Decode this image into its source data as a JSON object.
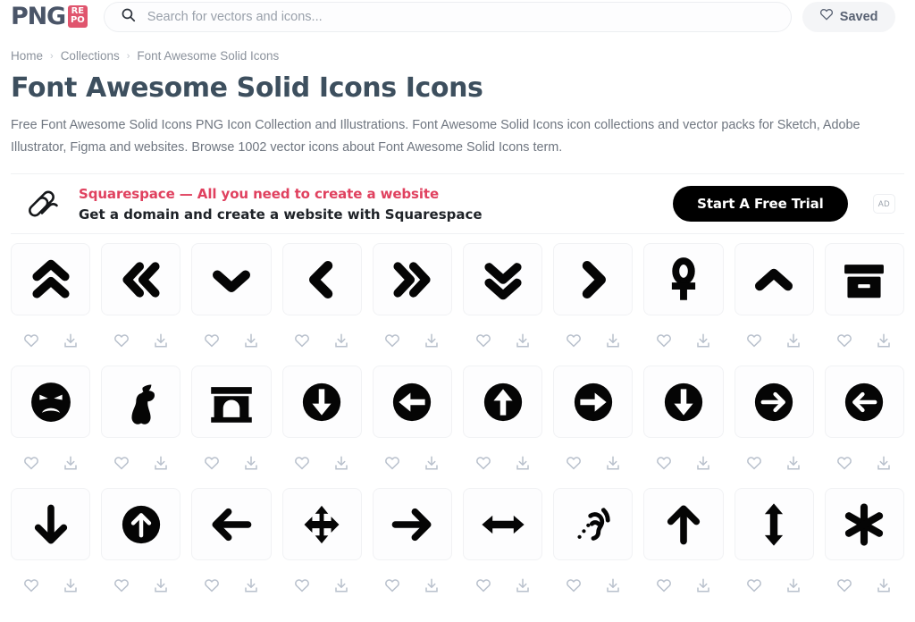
{
  "header": {
    "logo": {
      "text": "PNG",
      "badge_top": "RE",
      "badge_bottom": "PO",
      "badge_color": "#e0556e",
      "text_color": "#4a5568"
    },
    "search": {
      "placeholder": "Search for vectors and icons...",
      "value": "",
      "icon": "search-icon"
    },
    "saved": {
      "label": "Saved",
      "icon": "heart-icon"
    }
  },
  "breadcrumb": {
    "items": [
      {
        "label": "Home"
      },
      {
        "label": "Collections"
      },
      {
        "label": "Font Awesome Solid Icons"
      }
    ],
    "separator": "›"
  },
  "page": {
    "title": "Font Awesome Solid Icons Icons",
    "description": "Free Font Awesome Solid Icons PNG Icon Collection and Illustrations. Font Awesome Solid Icons icon collections and vector packs for Sketch, Adobe Illustrator, Figma and websites. Browse 1002 vector icons about Font Awesome Solid Icons term.",
    "icon_count": "1002"
  },
  "ad": {
    "logo_icon": "squarespace-logo-icon",
    "title": "Squarespace — All you need to create a website",
    "subtitle": "Get a domain and create a website with Squarespace",
    "cta_label": "Start A Free Trial",
    "badge_label": "AD",
    "title_color": "#e0415f",
    "cta_bg": "#000000"
  },
  "grid": {
    "card_actions": {
      "favorite_icon": "heart-icon",
      "download_icon": "download-icon"
    },
    "icons": [
      {
        "name": "angles-up-icon"
      },
      {
        "name": "angles-left-icon"
      },
      {
        "name": "angle-down-icon"
      },
      {
        "name": "angle-left-icon"
      },
      {
        "name": "angles-right-icon"
      },
      {
        "name": "angles-down-icon"
      },
      {
        "name": "angle-right-icon"
      },
      {
        "name": "ankh-icon"
      },
      {
        "name": "angle-up-icon"
      },
      {
        "name": "box-archive-icon"
      },
      {
        "name": "face-angry-icon"
      },
      {
        "name": "apple-whole-icon"
      },
      {
        "name": "archway-icon"
      },
      {
        "name": "circle-arrow-down-icon"
      },
      {
        "name": "circle-arrow-left-icon"
      },
      {
        "name": "circle-arrow-up-icon"
      },
      {
        "name": "circle-arrow-right-icon"
      },
      {
        "name": "circle-arrow-down-alt-icon"
      },
      {
        "name": "circle-arrow-right-thin-icon"
      },
      {
        "name": "circle-arrow-left-thin-icon"
      },
      {
        "name": "arrow-down-icon"
      },
      {
        "name": "circle-arrow-up-thin-icon"
      },
      {
        "name": "arrow-left-icon"
      },
      {
        "name": "arrows-up-down-left-right-icon"
      },
      {
        "name": "arrow-right-icon"
      },
      {
        "name": "arrows-left-right-icon"
      },
      {
        "name": "assistive-listening-systems-icon"
      },
      {
        "name": "arrow-up-icon"
      },
      {
        "name": "arrows-up-down-icon"
      },
      {
        "name": "asterisk-icon"
      }
    ]
  }
}
